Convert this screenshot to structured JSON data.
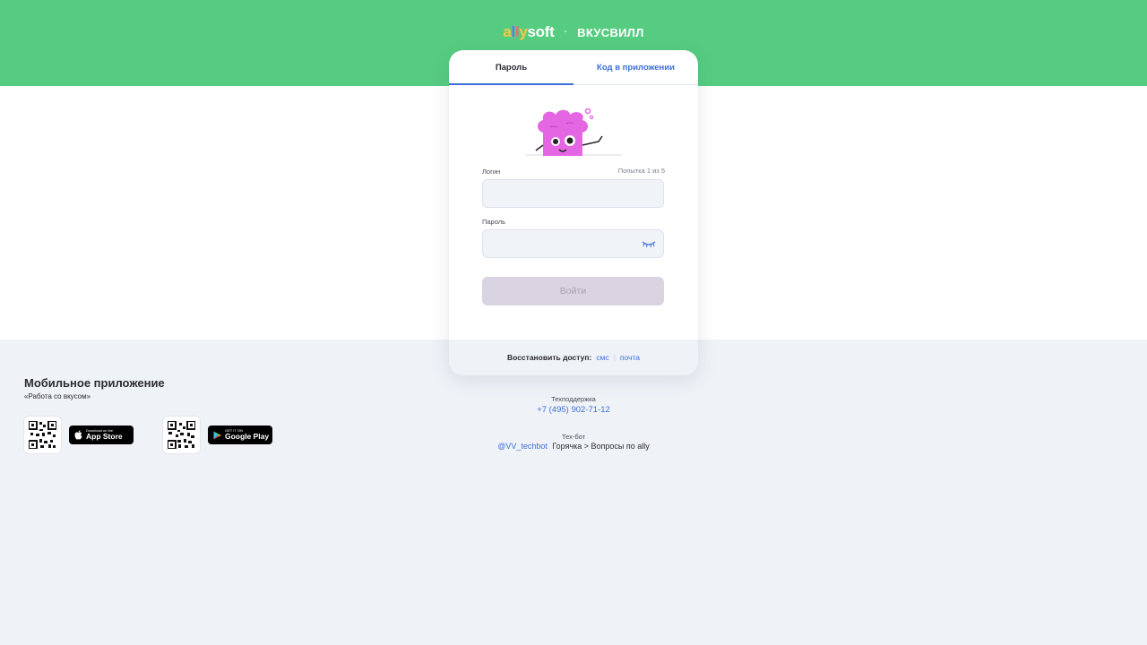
{
  "header": {
    "logo_parts": [
      "a",
      "l",
      "l",
      "y"
    ],
    "logo_suffix": "soft",
    "separator": "·",
    "partner": "ВКУСВИЛЛ",
    "background_color": "#56cc80"
  },
  "login_card": {
    "tabs": [
      {
        "label": "Пароль",
        "active": true
      },
      {
        "label": "Код в приложении",
        "active": false
      }
    ],
    "mascot_icon": "pink-cloud-mascot",
    "login_label": "Логин",
    "attempt_text": "Попытка 1 из 5",
    "login_value": "",
    "password_label": "Пароль",
    "password_value": "",
    "password_toggle_icon": "eye-closed-icon",
    "submit_label": "Войти",
    "restore": {
      "label": "Восстановить доступ:",
      "sms": "смс",
      "separator": "|",
      "email": "почта"
    }
  },
  "mobile_app": {
    "title": "Мобильное приложение",
    "subtitle": "«Работа со вкусом»",
    "app_store": {
      "small": "Download on the",
      "big": "App Store"
    },
    "google_play": {
      "small": "GET IT ON",
      "big": "Google Play"
    }
  },
  "support": {
    "label": "Техподдержка",
    "phone": "+7 (495) 902-71-12",
    "techbot_label": "Тех-бот",
    "techbot_handle": "@VV_techbot",
    "techbot_path": "Горячка > Вопросы по ally"
  },
  "colors": {
    "accent": "#3d6fd8",
    "page_background": "#eff2f7",
    "disabled_button": "#dad4e2"
  }
}
